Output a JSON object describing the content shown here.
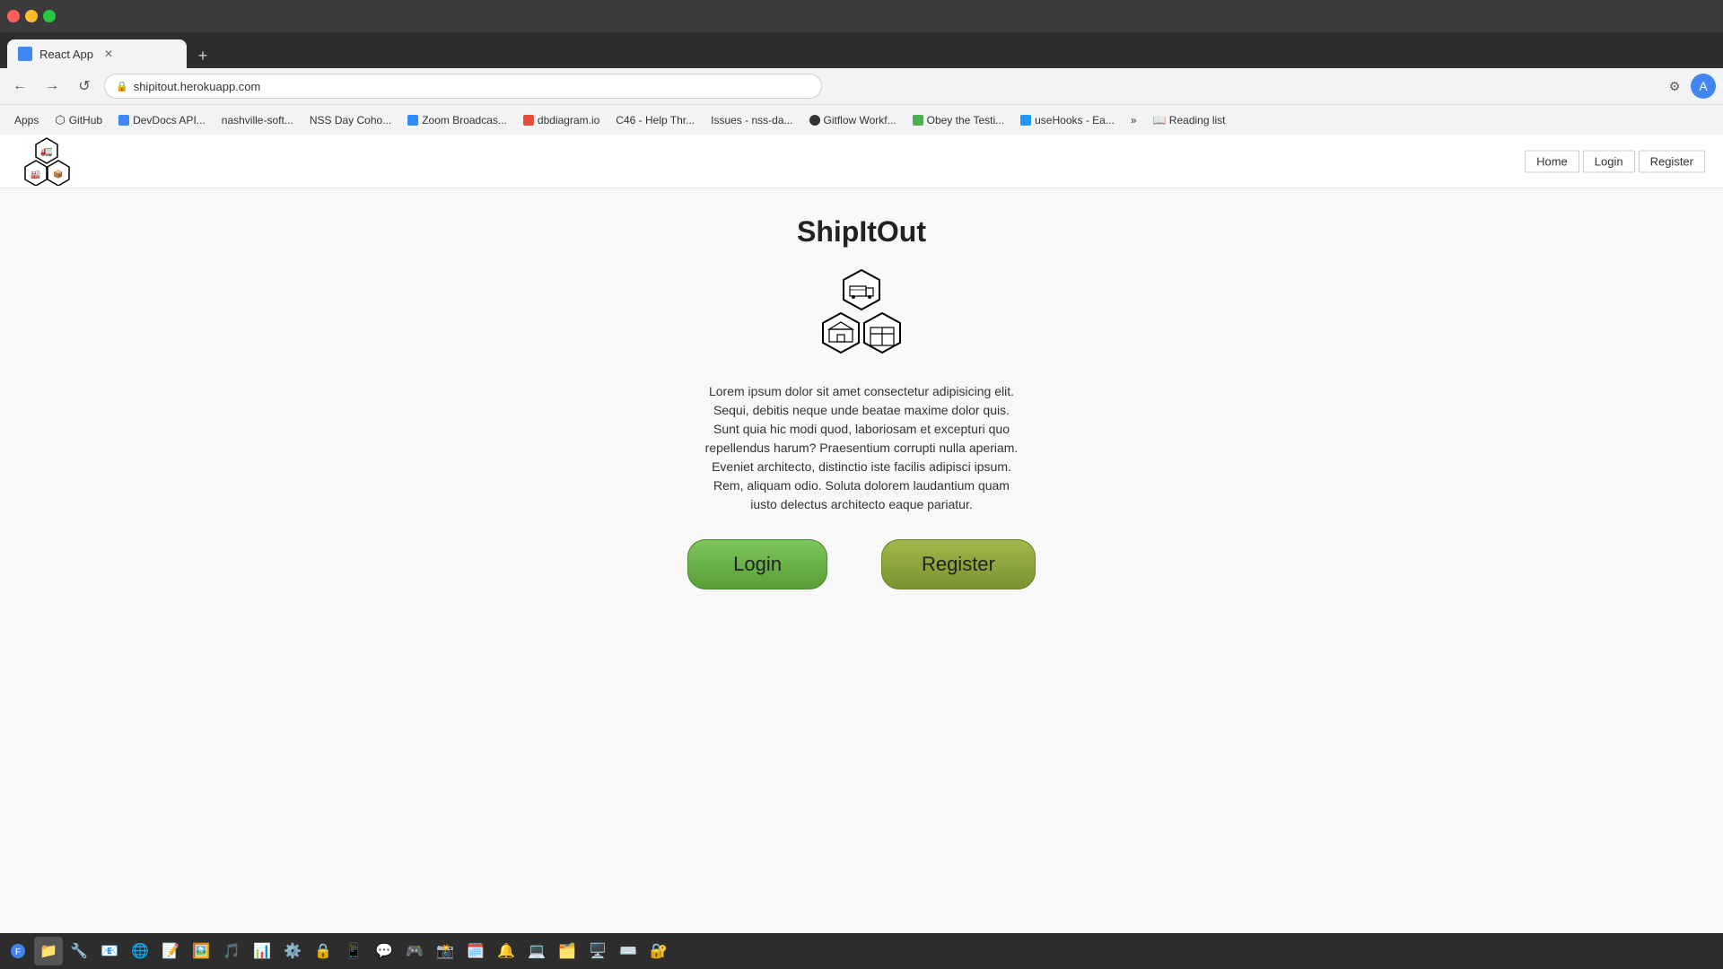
{
  "browser": {
    "tab_title": "React App",
    "url": "shipitout.herokuapp.com",
    "new_tab_symbol": "+",
    "back_symbol": "←",
    "forward_symbol": "→",
    "refresh_symbol": "↺"
  },
  "bookmarks": [
    {
      "label": "Apps",
      "color": "#e0e0e0"
    },
    {
      "label": "GitHub",
      "color": "#333"
    },
    {
      "label": "DevDocs API...",
      "color": "#4285f4"
    },
    {
      "label": "nashville-soft...",
      "color": "#e0e0e0"
    },
    {
      "label": "NSS Day Coho...",
      "color": "#e0e0e0"
    },
    {
      "label": "Zoom Broadcas...",
      "color": "#2d8cff"
    },
    {
      "label": "dbdiagram.io",
      "color": "#e74c3c"
    },
    {
      "label": "C46 - Help Thr...",
      "color": "#e0e0e0"
    },
    {
      "label": "Issues - nss-da...",
      "color": "#e0e0e0"
    },
    {
      "label": "Gitflow Workf...",
      "color": "#333"
    },
    {
      "label": "Obey the Testi...",
      "color": "#4caf50"
    },
    {
      "label": "useHooks - Ea...",
      "color": "#e0e0e0"
    }
  ],
  "navbar": {
    "home_label": "Home",
    "login_label": "Login",
    "register_label": "Register"
  },
  "main": {
    "title": "ShipItOut",
    "description": "Lorem ipsum dolor sit amet consectetur adipisicing elit. Sequi, debitis neque unde beatae maxime dolor quis. Sunt quia hic modi quod, laboriosam et excepturi quo repellendus harum? Praesentium corrupti nulla aperiam. Eveniet architecto, distinctio iste facilis adipisci ipsum. Rem, aliquam odio. Soluta dolorem laudantium quam iusto delectus architecto eaque pariatur.",
    "login_button": "Login",
    "register_button": "Register"
  }
}
